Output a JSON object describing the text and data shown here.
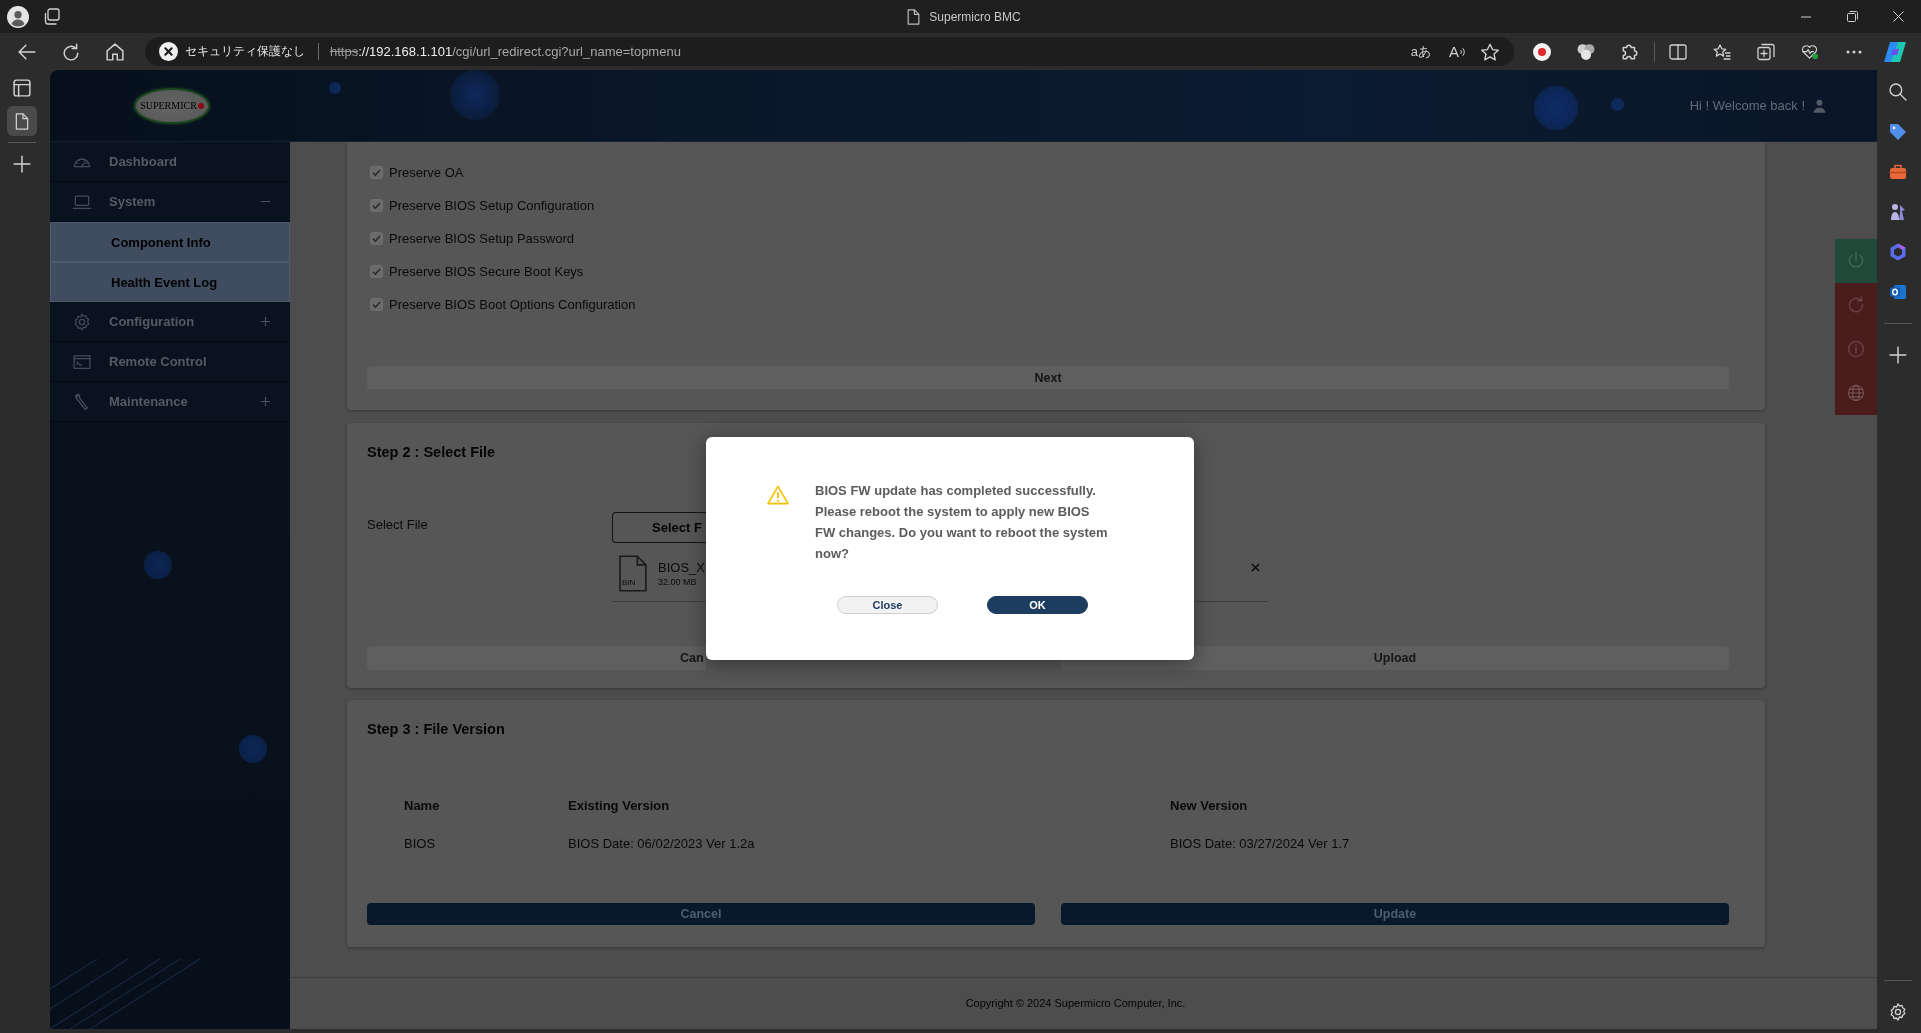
{
  "browser": {
    "window_title": "Supermicro BMC",
    "tabs": [
      {
        "selected": true
      }
    ],
    "security_label": "セキュリティ保護なし",
    "url": {
      "scheme": "https",
      "host": "://192.168.1.101",
      "path": "/cgi/url_redirect.cgi?url_name=topmenu"
    },
    "translate_glyph": "aあ",
    "read_aloud_glyph": "A"
  },
  "header": {
    "logo_text": "SUPERMICR",
    "greeting": "Hi ! Welcome back !"
  },
  "sidebar": {
    "items": [
      {
        "label": "Dashboard",
        "kind": "link"
      },
      {
        "label": "System",
        "kind": "group",
        "expanded": true,
        "children": [
          {
            "label": "Component Info"
          },
          {
            "label": "Health Event Log"
          }
        ]
      },
      {
        "label": "Configuration",
        "kind": "group",
        "expanded": false
      },
      {
        "label": "Remote Control",
        "kind": "link"
      },
      {
        "label": "Maintenance",
        "kind": "group",
        "expanded": false
      }
    ]
  },
  "step1": {
    "options": [
      {
        "label": "Preserve OA",
        "checked": true,
        "disabled": true
      },
      {
        "label": "Preserve BIOS Setup Configuration",
        "checked": true,
        "disabled": true
      },
      {
        "label": "Preserve BIOS Setup Password",
        "checked": true,
        "disabled": true
      },
      {
        "label": "Preserve BIOS Secure Boot Keys",
        "checked": true,
        "disabled": true
      },
      {
        "label": "Preserve BIOS Boot Options Configuration",
        "checked": true,
        "disabled": true
      }
    ],
    "next_button": {
      "label": "Next",
      "disabled": true
    }
  },
  "step2": {
    "title": "Step 2 : Select File",
    "field_label": "Select File",
    "select_button": "Select F",
    "file": {
      "name": "BIOS_X",
      "size": "32.00 MB",
      "type": "BIN"
    },
    "buttons": [
      {
        "label": "Can",
        "disabled": true
      },
      {
        "label": "Upload",
        "disabled": true
      }
    ]
  },
  "step3": {
    "title": "Step 3 : File Version",
    "columns": [
      "Name",
      "Existing Version",
      "New Version"
    ],
    "rows": [
      [
        "BIOS",
        "BIOS Date: 06/02/2023 Ver 1.2a",
        "BIOS Date: 03/27/2024 Ver 1.7"
      ]
    ],
    "buttons": [
      {
        "label": "Cancel",
        "disabled": false
      },
      {
        "label": "Update",
        "disabled": false
      }
    ]
  },
  "footer": {
    "copyright": "Copyright © 2024 Supermicro Computer, Inc."
  },
  "quick_actions": [
    {
      "color": "#1f4a3a"
    },
    {
      "color": "#4a1c1c"
    },
    {
      "color": "#4a1c1c"
    },
    {
      "color": "#4a1c1c"
    }
  ],
  "dialog": {
    "message": "BIOS FW update has completed successfully. Please reboot the system to apply new BIOS FW changes. Do you want to reboot the system now?",
    "buttons": [
      {
        "label": "Close",
        "kind": "secondary"
      },
      {
        "label": "OK",
        "kind": "primary"
      }
    ]
  }
}
